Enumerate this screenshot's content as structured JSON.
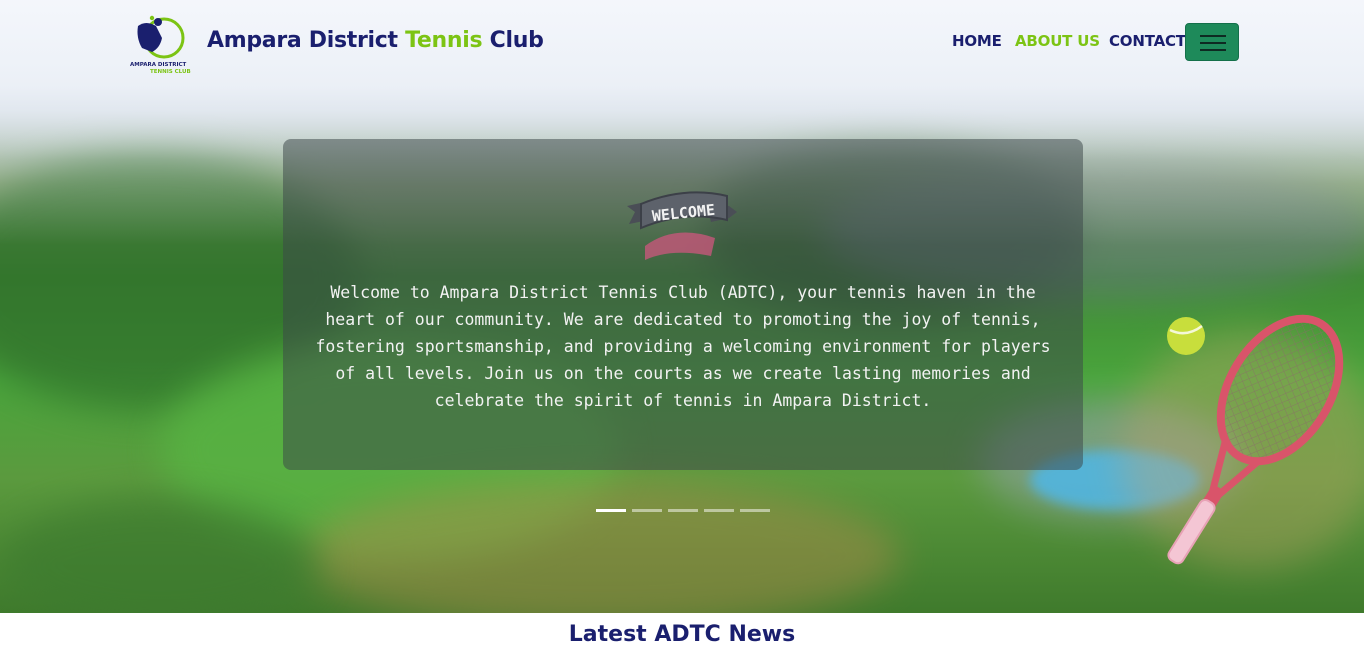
{
  "brand": {
    "name_part1": "Ampara District ",
    "name_accent": "Tennis",
    "name_part2": " Club",
    "logo_text_line1": "AMPARA DISTRICT",
    "logo_text_line2": "TENNIS CLUB"
  },
  "nav": {
    "items": [
      {
        "label": "HOME",
        "active": false
      },
      {
        "label": "ABOUT US",
        "active": true
      },
      {
        "label": "CONTACT",
        "active": false
      }
    ],
    "menu_icon": "hamburger-icon"
  },
  "hero": {
    "badge_text": "WELCOME",
    "body": "Welcome to Ampara District Tennis Club (ADTC), your tennis haven in the heart of our community. We are dedicated to promoting the joy of tennis, fostering sportsmanship, and providing a welcoming environment for players of all levels. Join us on the courts as we create lasting memories and celebrate the spirit of tennis in Ampara District.",
    "slide_count": 5,
    "active_slide": 1
  },
  "news": {
    "title": "Latest ADTC News"
  },
  "colors": {
    "navy": "#1a1f6e",
    "lime": "#7cc414",
    "menu_button": "#1e8a5a"
  }
}
